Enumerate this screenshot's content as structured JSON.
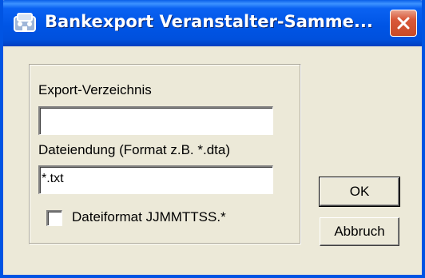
{
  "window": {
    "title": "Bankexport Veranstalter-Samme...",
    "close_icon": "close-icon"
  },
  "form": {
    "export_dir_label": "Export-Verzeichnis",
    "export_dir_value": "",
    "extension_label": "Dateiendung (Format z.B. *.dta)",
    "extension_value": "*.txt",
    "fileformat_checkbox_label": "Dateiformat JJMMTTSS.*",
    "fileformat_checked": false
  },
  "buttons": {
    "ok_label": "OK",
    "cancel_label": "Abbruch"
  },
  "colors": {
    "titlebar": "#0055e5",
    "dialog_bg": "#ece9d8",
    "close_button": "#d9593a"
  }
}
